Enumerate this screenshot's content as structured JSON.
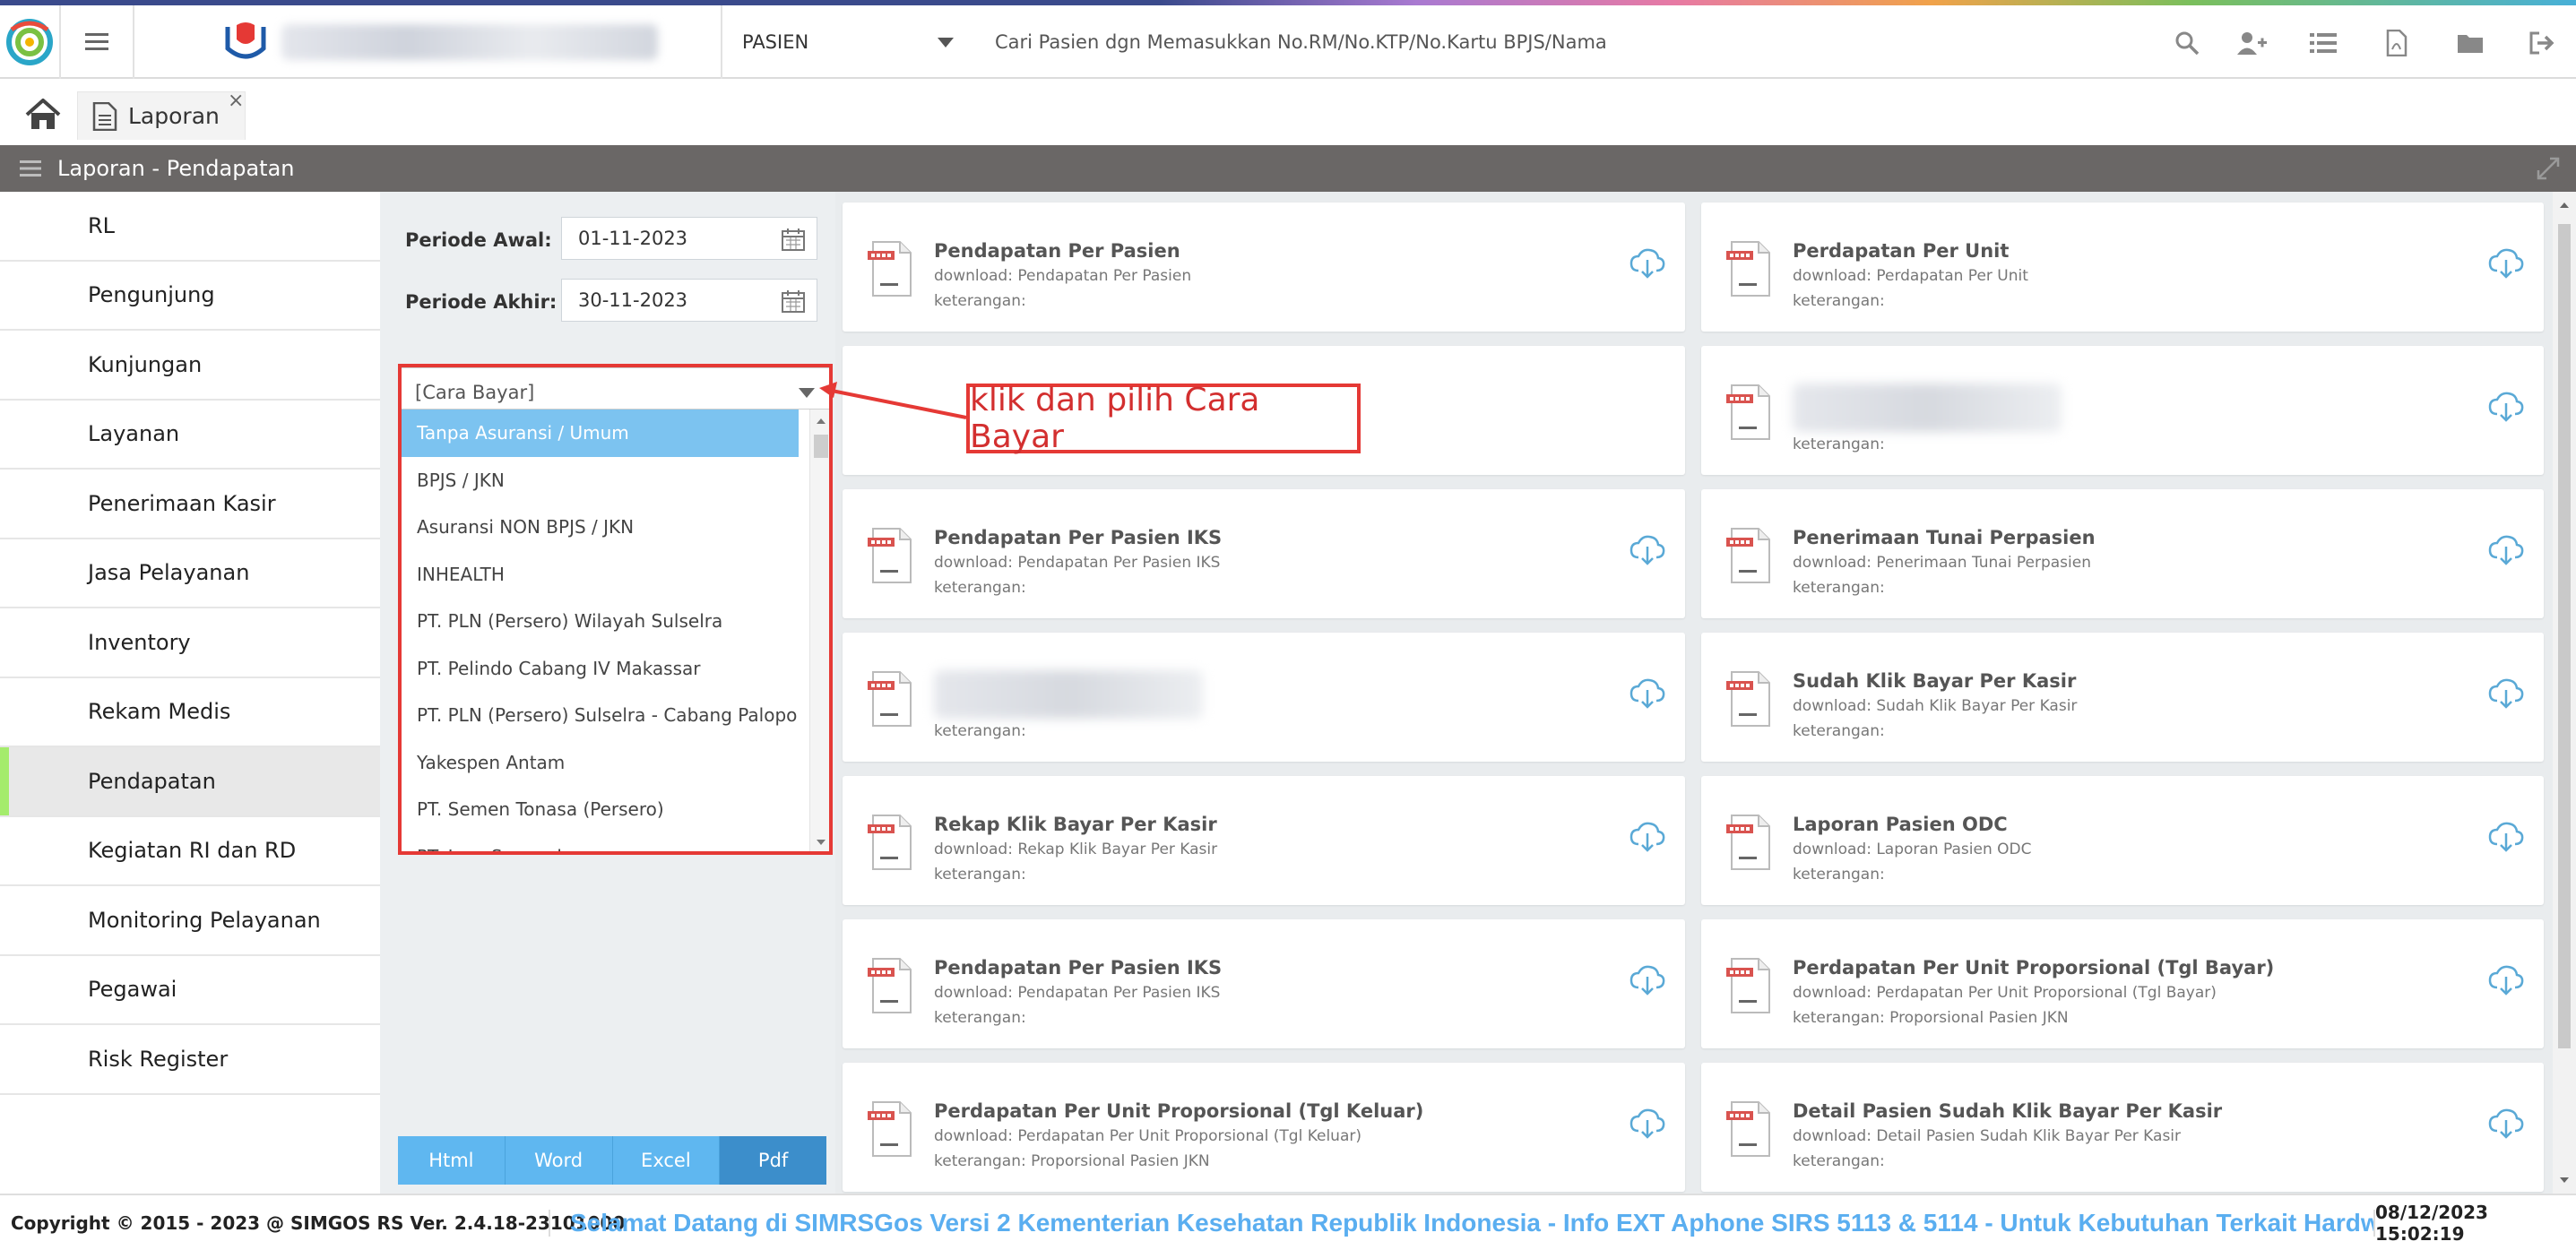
{
  "navbar": {
    "patient_type": "PASIEN",
    "search_placeholder": "Cari Pasien dgn Memasukkan No.RM/No.KTP/No.Kartu BPJS/Nama"
  },
  "tabs": [
    {
      "label": "Laporan",
      "close": "×"
    }
  ],
  "title_bar": {
    "title": "Laporan - Pendapatan"
  },
  "sidebar": {
    "items": [
      {
        "label": "RL"
      },
      {
        "label": "Pengunjung"
      },
      {
        "label": "Kunjungan"
      },
      {
        "label": "Layanan"
      },
      {
        "label": "Penerimaan Kasir"
      },
      {
        "label": "Jasa Pelayanan"
      },
      {
        "label": "Inventory"
      },
      {
        "label": "Rekam Medis"
      },
      {
        "label": "Pendapatan",
        "active": true
      },
      {
        "label": "Kegiatan RI dan RD"
      },
      {
        "label": "Monitoring Pelayanan"
      },
      {
        "label": "Pegawai"
      },
      {
        "label": "Risk Register"
      }
    ]
  },
  "filter": {
    "periode_awal_label": "Periode Awal:",
    "periode_awal_value": "01-11-2023",
    "periode_akhir_label": "Periode Akhir:",
    "periode_akhir_value": "30-11-2023",
    "cara_bayar_placeholder": "[Cara Bayar]",
    "cara_bayar_options": [
      "Tanpa Asuransi / Umum",
      "BPJS / JKN",
      "Asuransi NON BPJS / JKN",
      "INHEALTH",
      "PT. PLN (Persero) Wilayah Sulselra",
      "PT. Pelindo Cabang IV Makassar",
      "PT. PLN (Persero) Sulselra - Cabang Palopo",
      "Yakespen Antam",
      "PT. Semen Tonasa (Persero)",
      "PT. Inco Sorowako"
    ],
    "selected_index": 0
  },
  "annotation": {
    "callout_text": "klik dan pilih Cara Bayar",
    "color": "#e53935"
  },
  "export_buttons": [
    "Html",
    "Word",
    "Excel",
    "Pdf"
  ],
  "reports": {
    "left": [
      {
        "title": "Pendapatan Per Pasien",
        "download": "download: Pendapatan Per Pasien",
        "keterangan": "keterangan:"
      },
      {
        "blank": true
      },
      {
        "title": "Pendapatan Per Pasien IKS",
        "download": "download: Pendapatan Per Pasien IKS",
        "keterangan": "keterangan:"
      },
      {
        "blurred": true,
        "keterangan": "keterangan:"
      },
      {
        "title": "Rekap Klik Bayar Per Kasir",
        "download": "download: Rekap Klik Bayar Per Kasir",
        "keterangan": "keterangan:"
      },
      {
        "title": "Pendapatan Per Pasien IKS",
        "download": "download: Pendapatan Per Pasien IKS",
        "keterangan": "keterangan:"
      },
      {
        "title": "Perdapatan Per Unit Proporsional (Tgl Keluar)",
        "download": "download: Perdapatan Per Unit Proporsional (Tgl Keluar)",
        "keterangan": "keterangan: Proporsional Pasien JKN"
      }
    ],
    "right": [
      {
        "title": "Perdapatan Per Unit",
        "download": "download: Perdapatan Per Unit",
        "keterangan": "keterangan:"
      },
      {
        "blurred": true,
        "keterangan": "keterangan:"
      },
      {
        "title": "Penerimaan Tunai Perpasien",
        "download": "download: Penerimaan Tunai Perpasien",
        "keterangan": "keterangan:"
      },
      {
        "title": "Sudah Klik Bayar Per Kasir",
        "download": "download: Sudah Klik Bayar Per Kasir",
        "keterangan": "keterangan:"
      },
      {
        "title": "Laporan Pasien ODC",
        "download": "download: Laporan Pasien ODC",
        "keterangan": "keterangan:"
      },
      {
        "title": "Perdapatan Per Unit Proporsional (Tgl Bayar)",
        "download": "download: Perdapatan Per Unit Proporsional (Tgl Bayar)",
        "keterangan": "keterangan: Proporsional Pasien JKN"
      },
      {
        "title": "Detail Pasien Sudah Klik Bayar Per Kasir",
        "download": "download: Detail Pasien Sudah Klik Bayar Per Kasir",
        "keterangan": "keterangan:"
      }
    ]
  },
  "footer": {
    "copyright": "Copyright © 2015 - 2023 @ SIMGOS RS Ver. 2.4.18-23101000",
    "ticker": "Selamat Datang di SIMRSGos Versi 2 Kementerian Kesehatan Republik Indonesia - Info EXT Aphone SIRS 5113 & 5114 - Untuk Kebutuhan Terkait Hardware",
    "datetime": "08/12/2023 15:02:19"
  },
  "icons": {
    "navbar_right": [
      "search-icon",
      "add-user-icon",
      "list-icon",
      "pdf-file-icon",
      "folder-icon",
      "logout-icon"
    ],
    "card_icon": "pdf-report-icon",
    "download_icon": "cloud-download-icon"
  },
  "colors": {
    "accent": "#5fb7f0",
    "title_bar": "#6a6766",
    "active_marker": "#a4ec6c",
    "selected_option": "#7cc3f0"
  }
}
